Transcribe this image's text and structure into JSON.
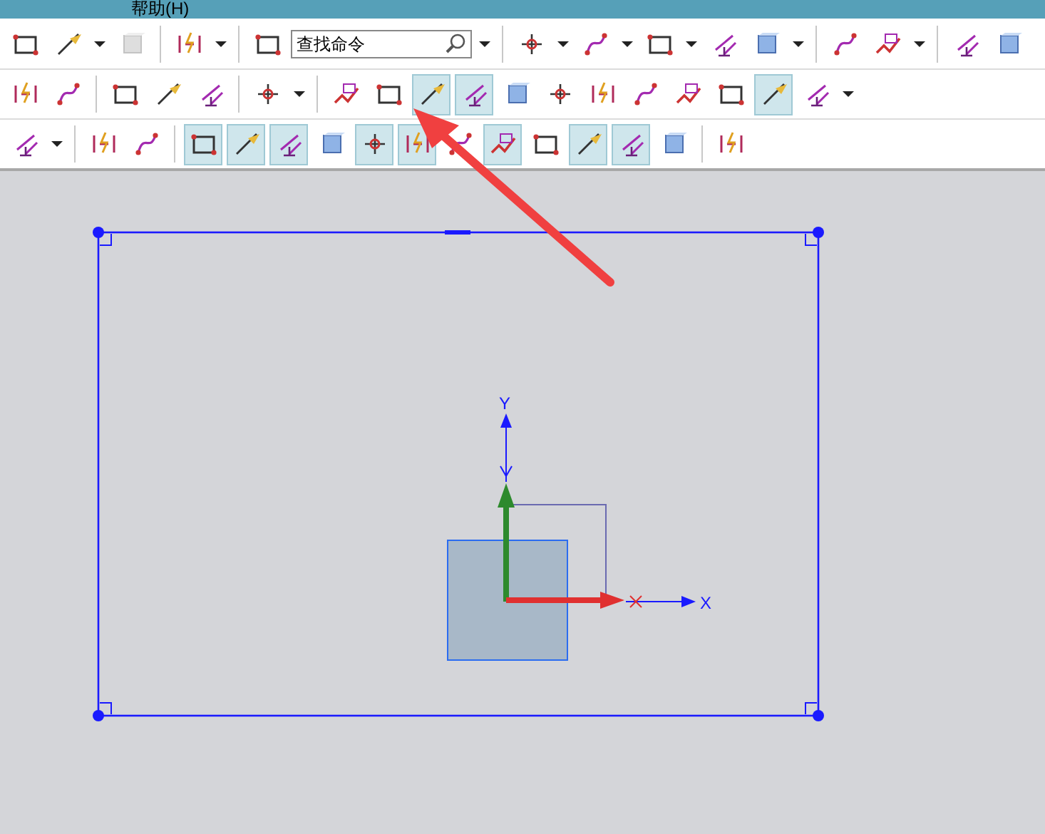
{
  "menu_bar": {
    "items": [
      "帮助(H)"
    ]
  },
  "toolbar": {
    "rows": [
      [
        {
          "kind": "tool",
          "selected": false
        },
        {
          "kind": "tool",
          "selected": false
        },
        {
          "kind": "dropdown"
        },
        {
          "kind": "tool",
          "selected": false,
          "disabled": true
        },
        {
          "kind": "separator"
        },
        {
          "kind": "tool",
          "selected": false
        },
        {
          "kind": "dropdown"
        },
        {
          "kind": "separator"
        },
        {
          "kind": "tool",
          "selected": false
        },
        {
          "kind": "search",
          "value": "查找命令"
        },
        {
          "kind": "dropdown"
        },
        {
          "kind": "separator"
        },
        {
          "kind": "tool",
          "selected": false
        },
        {
          "kind": "dropdown"
        },
        {
          "kind": "tool",
          "selected": false
        },
        {
          "kind": "dropdown"
        },
        {
          "kind": "tool",
          "selected": false
        },
        {
          "kind": "dropdown"
        },
        {
          "kind": "tool",
          "selected": false
        },
        {
          "kind": "tool",
          "selected": false
        },
        {
          "kind": "dropdown"
        },
        {
          "kind": "separator"
        },
        {
          "kind": "tool",
          "selected": false
        },
        {
          "kind": "tool",
          "selected": false
        },
        {
          "kind": "dropdown"
        },
        {
          "kind": "separator"
        },
        {
          "kind": "tool",
          "selected": false
        },
        {
          "kind": "tool",
          "selected": false
        }
      ],
      [
        {
          "kind": "tool",
          "selected": false
        },
        {
          "kind": "tool",
          "selected": false
        },
        {
          "kind": "separator"
        },
        {
          "kind": "tool",
          "selected": false
        },
        {
          "kind": "tool",
          "selected": false
        },
        {
          "kind": "tool",
          "selected": false
        },
        {
          "kind": "separator"
        },
        {
          "kind": "tool",
          "selected": false
        },
        {
          "kind": "dropdown"
        },
        {
          "kind": "separator"
        },
        {
          "kind": "tool",
          "selected": false
        },
        {
          "kind": "tool",
          "selected": false
        },
        {
          "kind": "tool",
          "selected": true
        },
        {
          "kind": "tool",
          "selected": true
        },
        {
          "kind": "tool",
          "selected": false
        },
        {
          "kind": "tool",
          "selected": false
        },
        {
          "kind": "tool",
          "selected": false
        },
        {
          "kind": "tool",
          "selected": false
        },
        {
          "kind": "tool",
          "selected": false
        },
        {
          "kind": "tool",
          "selected": false
        },
        {
          "kind": "tool",
          "selected": true
        },
        {
          "kind": "tool",
          "selected": false
        },
        {
          "kind": "dropdown"
        }
      ],
      [
        {
          "kind": "tool",
          "selected": false
        },
        {
          "kind": "dropdown"
        },
        {
          "kind": "separator"
        },
        {
          "kind": "tool",
          "selected": false
        },
        {
          "kind": "tool",
          "selected": false
        },
        {
          "kind": "separator"
        },
        {
          "kind": "tool",
          "selected": true
        },
        {
          "kind": "tool",
          "selected": true
        },
        {
          "kind": "tool",
          "selected": true
        },
        {
          "kind": "tool",
          "selected": false
        },
        {
          "kind": "tool",
          "selected": true
        },
        {
          "kind": "tool",
          "selected": true
        },
        {
          "kind": "tool",
          "selected": false
        },
        {
          "kind": "tool",
          "selected": true
        },
        {
          "kind": "tool",
          "selected": false
        },
        {
          "kind": "tool",
          "selected": true
        },
        {
          "kind": "tool",
          "selected": true
        },
        {
          "kind": "tool",
          "selected": false
        },
        {
          "kind": "separator"
        },
        {
          "kind": "tool",
          "selected": false
        }
      ]
    ]
  },
  "canvas": {
    "axis_labels": [
      "Y",
      "X"
    ]
  }
}
